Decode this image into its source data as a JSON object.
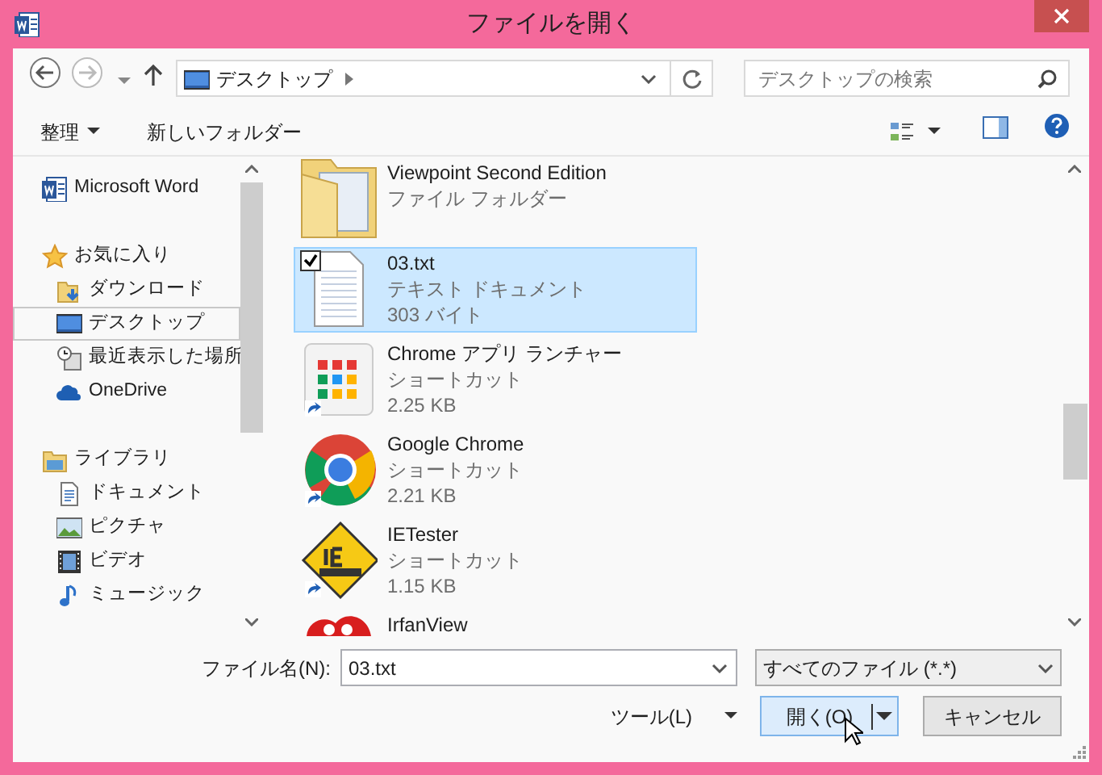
{
  "window": {
    "title": "ファイルを開く"
  },
  "address": {
    "path": "デスクトップ"
  },
  "search": {
    "placeholder": "デスクトップの検索"
  },
  "toolbar": {
    "organize": "整理",
    "new_folder": "新しいフォルダー"
  },
  "sidebar": {
    "items": [
      {
        "label": "Microsoft Word",
        "kind": "word",
        "selected": false
      },
      {
        "label": "お気に入り",
        "kind": "star",
        "selected": false,
        "children": [
          {
            "label": "ダウンロード",
            "kind": "download",
            "selected": false
          },
          {
            "label": "デスクトップ",
            "kind": "desktop",
            "selected": true
          },
          {
            "label": "最近表示した場所",
            "kind": "recent",
            "selected": false
          },
          {
            "label": "OneDrive",
            "kind": "cloud",
            "selected": false
          }
        ]
      },
      {
        "label": "ライブラリ",
        "kind": "library",
        "selected": false,
        "children": [
          {
            "label": "ドキュメント",
            "kind": "document",
            "selected": false
          },
          {
            "label": "ピクチャ",
            "kind": "picture",
            "selected": false
          },
          {
            "label": "ビデオ",
            "kind": "video",
            "selected": false
          },
          {
            "label": "ミュージック",
            "kind": "music",
            "selected": false
          }
        ]
      }
    ]
  },
  "files": [
    {
      "name": "Viewpoint Second Edition",
      "type": "ファイル フォルダー",
      "kind": "folder",
      "selected": false,
      "checked": false
    },
    {
      "name": "03.txt",
      "type": "テキスト ドキュメント",
      "size": "303 バイト",
      "kind": "text",
      "selected": true,
      "checked": true
    },
    {
      "name": "Chrome アプリ ランチャー",
      "type": "ショートカット",
      "size": "2.25 KB",
      "kind": "launcher",
      "selected": false,
      "checked": false
    },
    {
      "name": "Google Chrome",
      "type": "ショートカット",
      "size": "2.21 KB",
      "kind": "chrome",
      "selected": false,
      "checked": false
    },
    {
      "name": "IETester",
      "type": "ショートカット",
      "size": "1.15 KB",
      "kind": "ietester",
      "selected": false,
      "checked": false
    },
    {
      "name": "IrfanView",
      "kind": "irfanview",
      "selected": false,
      "checked": false
    }
  ],
  "footer": {
    "filename_label": "ファイル名(N):",
    "filename": "03.txt",
    "filter": "すべてのファイル (*.*)",
    "tools": "ツール(L)",
    "open": "開く(O)",
    "cancel": "キャンセル"
  }
}
